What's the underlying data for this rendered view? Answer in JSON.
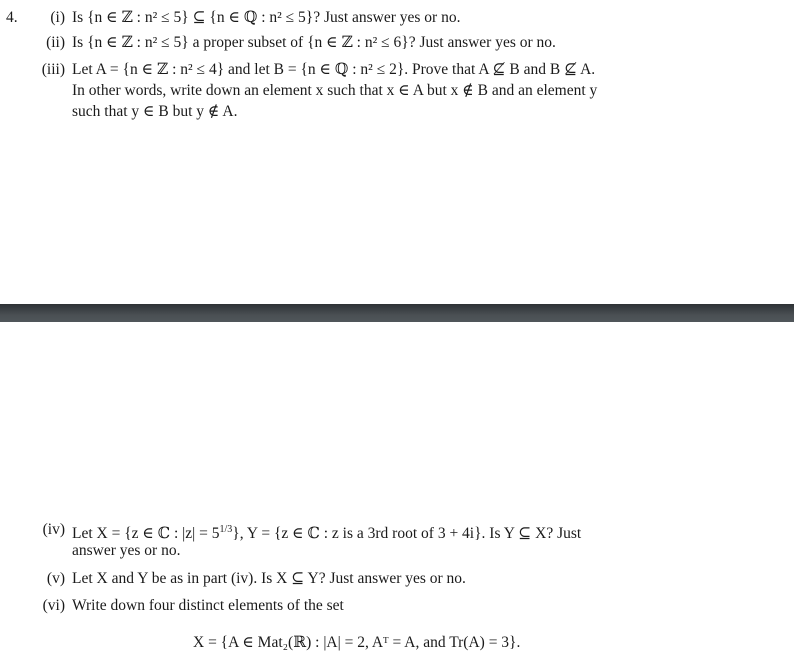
{
  "problem": {
    "number": "4.",
    "parts_top": [
      {
        "label": "(i)",
        "lines": [
          "Is {n ∈ ℤ : n² ≤ 5} ⊆ {n ∈ ℚ : n² ≤ 5}? Just answer yes or no."
        ]
      },
      {
        "label": "(ii)",
        "lines": [
          "Is {n ∈ ℤ : n² ≤ 5} a proper subset of {n ∈ ℤ : n² ≤ 6}? Just answer yes or no."
        ]
      },
      {
        "label": "(iii)",
        "lines": [
          "Let A = {n ∈ ℤ : n² ≤ 4} and let B = {n ∈ ℚ : n² ≤ 2}. Prove that A ⊈ B and B ⊈ A.",
          "In other words, write down an element x such that x ∈ A but x ∉ B and an element y",
          "such that y ∈ B but y ∉ A."
        ]
      }
    ],
    "parts_bottom": [
      {
        "label": "(iv)",
        "lines": [
          "Let X = {z ∈ ℂ : |z| = 5^{1/3}}, Y = {z ∈ ℂ : z is a 3rd root of 3 + 4i}. Is Y ⊆ X? Just",
          "answer yes or no."
        ]
      },
      {
        "label": "(v)",
        "lines": [
          "Let X and Y be as in part (iv). Is X ⊆ Y? Just answer yes or no."
        ]
      },
      {
        "label": "(vi)",
        "lines": [
          "Write down four distinct elements of the set"
        ]
      }
    ],
    "display_equation": "X = {A ∈ Mat₂(ℝ) : |A| = 2, Aᵀ = A, and Tr(A) = 3}."
  },
  "divider": {
    "color_top": "#2e3235",
    "color_bottom": "#50565a"
  }
}
